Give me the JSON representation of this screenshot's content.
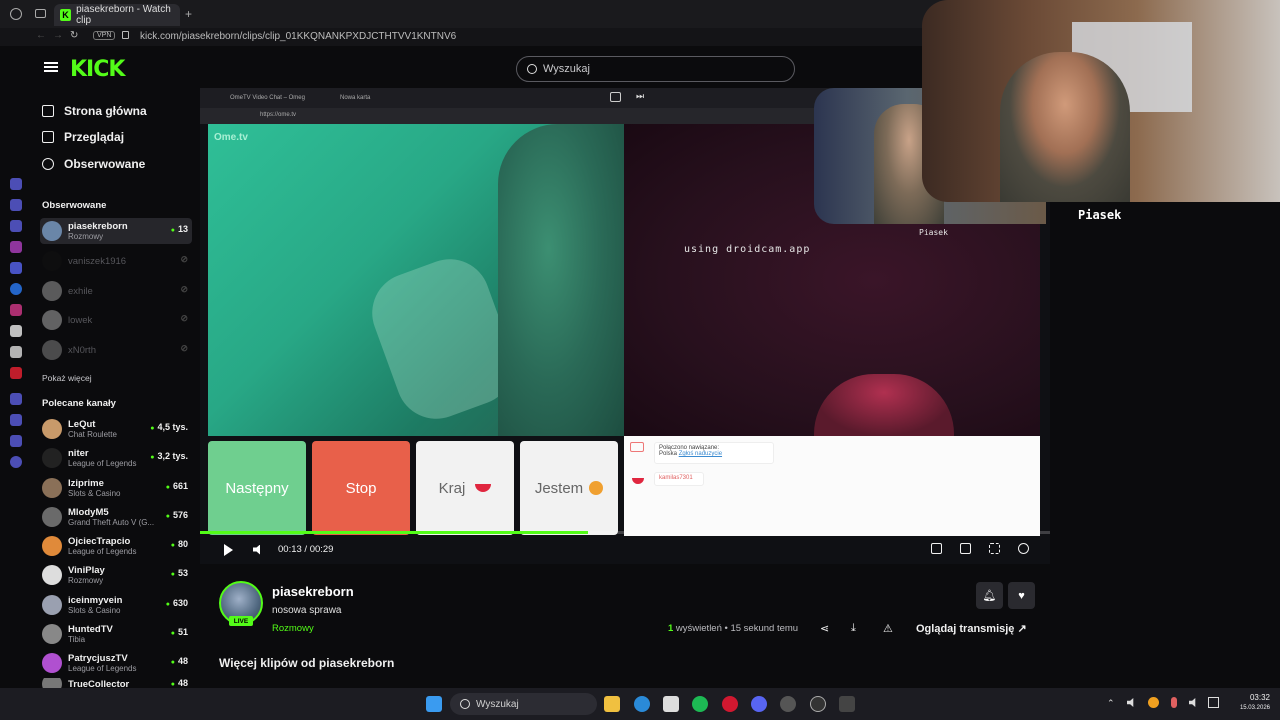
{
  "browser": {
    "tab_title": "piasekreborn - Watch clip",
    "url": "kick.com/piasekreborn/clips/clip_01KKQNANKPXDJCTHTVV1KNTNV6",
    "vpn_label": "VPN"
  },
  "header": {
    "logo": "KICK",
    "search_placeholder": "Wyszukaj"
  },
  "nav": {
    "home": "Strona główna",
    "browse": "Przeglądaj",
    "following": "Obserwowane"
  },
  "following": {
    "title": "Obserwowane",
    "channels": [
      {
        "name": "piasekreborn",
        "category": "Rozmowy",
        "viewers": "13",
        "live": true
      },
      {
        "name": "vaniszek1916",
        "category": "",
        "viewers": "",
        "live": false
      },
      {
        "name": "exhile",
        "category": "",
        "viewers": "",
        "live": false
      },
      {
        "name": "lowek",
        "category": "",
        "viewers": "",
        "live": false
      },
      {
        "name": "xN0rth",
        "category": "",
        "viewers": "",
        "live": false
      }
    ],
    "show_more": "Pokaż więcej"
  },
  "recommended": {
    "title": "Polecane kanały",
    "channels": [
      {
        "name": "LeQut",
        "category": "Chat Roulette",
        "viewers": "4,5 tys."
      },
      {
        "name": "niter",
        "category": "League of Legends",
        "viewers": "3,2 tys."
      },
      {
        "name": "Iziprime",
        "category": "Slots & Casino",
        "viewers": "661"
      },
      {
        "name": "MlodyM5",
        "category": "Grand Theft Auto V (G...",
        "viewers": "576"
      },
      {
        "name": "OjciecTrapcio",
        "category": "League of Legends",
        "viewers": "80"
      },
      {
        "name": "ViniPlay",
        "category": "Rozmowy",
        "viewers": "53"
      },
      {
        "name": "iceinmyvein",
        "category": "Slots & Casino",
        "viewers": "630"
      },
      {
        "name": "HuntedTV",
        "category": "Tibia",
        "viewers": "51"
      },
      {
        "name": "PatrycjuszTV",
        "category": "League of Legends",
        "viewers": "48"
      },
      {
        "name": "TrueCollector",
        "category": "",
        "viewers": "48"
      }
    ]
  },
  "video": {
    "inner_tab1": "OmeTV Video Chat – Omeg",
    "inner_tab2": "Nowa karta",
    "inner_url": "https://ome.tv",
    "omelogo": "Ome.tv",
    "droidcam_text": "using droidcam.app",
    "btn_next": "Następny",
    "btn_stop": "Stop",
    "btn_country": "Kraj",
    "btn_i_am": "Jestem",
    "chat_line1": "Połączono nawiązane:",
    "chat_line2": "Polska",
    "chat_link": "Zgłoś naduzycie",
    "chat_line3": "kamilas7301",
    "time": "00:13 / 00:29",
    "progress": 0.456
  },
  "webcam": {
    "name": "Piasek",
    "name_small": "Piasek"
  },
  "clip": {
    "channel": "piasekreborn",
    "live_badge": "LIVE",
    "title": "nosowa sprawa",
    "category": "Rozmowy",
    "views_count": "1",
    "views_text": " wyświetleń • 15 sekund temu",
    "watch_stream": "Oglądaj transmisję",
    "more_clips": "Więcej klipów od piasekreborn"
  },
  "taskbar": {
    "search": "Wyszukaj",
    "time": "03:32",
    "date": "15.03.2026"
  },
  "colors": {
    "accent": "#53fc18",
    "stop_red": "#e8604a",
    "next_green": "#6fcf8f"
  }
}
